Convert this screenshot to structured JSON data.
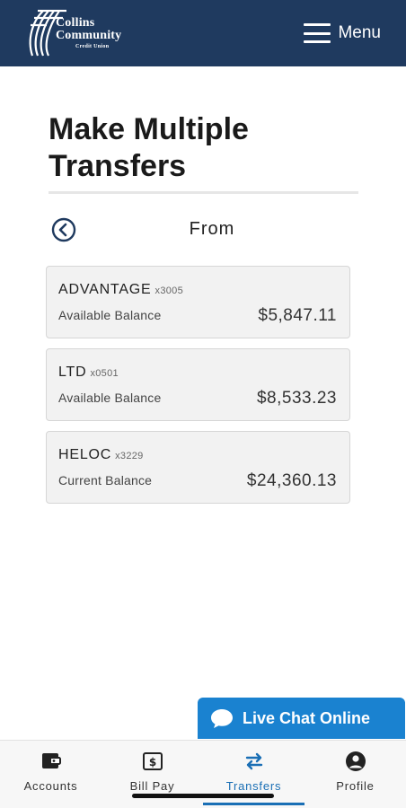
{
  "header": {
    "logo_line1": "Collins",
    "logo_line2": "Community",
    "logo_line3": "Credit Union",
    "menu_label": "Menu",
    "menu_icon": "hamburger-icon",
    "background_color": "#1f3a5f"
  },
  "page": {
    "title": "Make Multiple Transfers",
    "step_label": "From",
    "back_icon": "chevron-left-circle-icon"
  },
  "accounts": [
    {
      "name": "ADVANTAGE",
      "number": "x3005",
      "balance_label": "Available Balance",
      "balance": "$5,847.11"
    },
    {
      "name": "LTD",
      "number": "x0501",
      "balance_label": "Available Balance",
      "balance": "$8,533.23"
    },
    {
      "name": "HELOC",
      "number": "x3229",
      "balance_label": "Current Balance",
      "balance": "$24,360.13"
    }
  ],
  "chat": {
    "label": "Live Chat Online",
    "icon": "chat-bubble-icon",
    "color": "#1a82d0"
  },
  "tabs": [
    {
      "label": "Accounts",
      "icon": "wallet-icon",
      "active": false
    },
    {
      "label": "Bill Pay",
      "icon": "dollar-bill-icon",
      "active": false
    },
    {
      "label": "Transfers",
      "icon": "transfer-arrows-icon",
      "active": true
    },
    {
      "label": "Profile",
      "icon": "profile-icon",
      "active": false
    }
  ],
  "accent_color": "#1a6fb5"
}
